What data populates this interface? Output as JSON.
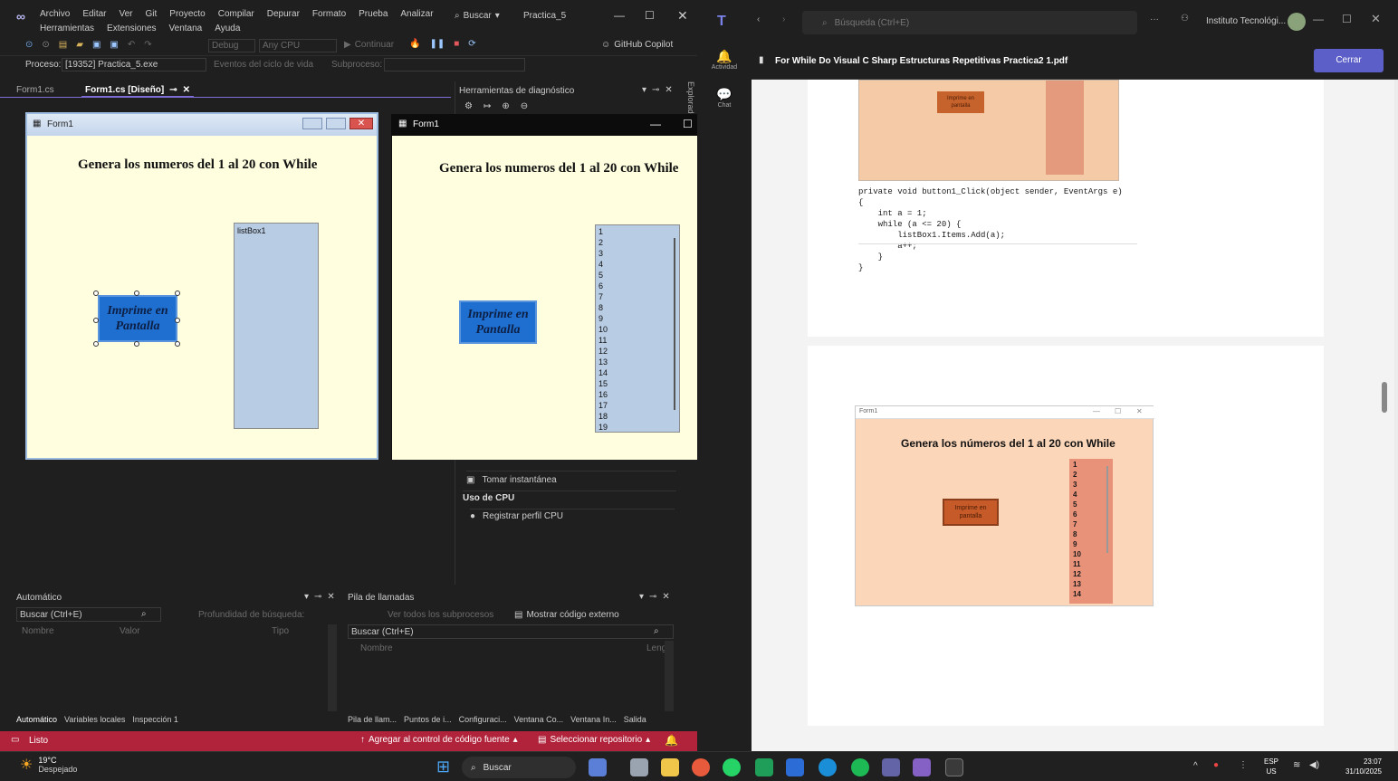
{
  "vs": {
    "menu": [
      "Archivo",
      "Editar",
      "Ver",
      "Git",
      "Proyecto",
      "Compilar",
      "Depurar",
      "Formato",
      "Prueba",
      "Analizar"
    ],
    "menu2": [
      "Herramientas",
      "Extensiones",
      "Ventana",
      "Ayuda"
    ],
    "search_label": "Buscar",
    "project_title": "Practica_5",
    "toolbar": {
      "config": "Debug",
      "platform": "Any CPU",
      "continue": "Continuar",
      "copilot": "GitHub Copilot"
    },
    "process_label": "Proceso:",
    "process_value": "[19352] Practica_5.exe",
    "lifecycle": "Eventos del ciclo de vida",
    "thread": "Subproceso:",
    "tabs": [
      "Form1.cs",
      "Form1.cs [Diseño]"
    ],
    "diag_title": "Herramientas de diagnóstico",
    "snapshot": "Tomar instantánea",
    "cpu_section": "Uso de CPU",
    "cpu_record": "Registrar perfil CPU",
    "auto_panel": {
      "title": "Automático",
      "search": "Buscar (Ctrl+E)",
      "depth": "Profundidad de búsqueda:",
      "cols": [
        "Nombre",
        "Valor",
        "Tipo"
      ],
      "tabs": [
        "Automático",
        "Variables locales",
        "Inspección 1"
      ]
    },
    "call_panel": {
      "title": "Pila de llamadas",
      "view_all": "Ver todos los subprocesos",
      "show_ext": "Mostrar código externo",
      "search": "Buscar (Ctrl+E)",
      "cols": [
        "Nombre",
        "Leng"
      ],
      "tabs": [
        "Pila de llam...",
        "Puntos de i...",
        "Configuraci...",
        "Ventana Co...",
        "Ventana In...",
        "Salida"
      ]
    },
    "status": {
      "ready": "Listo",
      "add_source": "Agregar al control de código fuente",
      "select_repo": "Seleccionar repositorio"
    },
    "side_tab": "Explorador"
  },
  "design_form": {
    "title": "Form1",
    "heading": "Genera los numeros del 1 al 20 con While",
    "button": "Imprime en Pantalla",
    "listbox_label": "listBox1"
  },
  "run_form": {
    "title": "Form1",
    "heading": "Genera los numeros del 1 al 20 con While",
    "button": "Imprime en Pantalla",
    "items": [
      "1",
      "2",
      "3",
      "4",
      "5",
      "6",
      "7",
      "8",
      "9",
      "10",
      "11",
      "12",
      "13",
      "14",
      "15",
      "16",
      "17",
      "18",
      "19"
    ]
  },
  "teams": {
    "search": "Búsqueda (Ctrl+E)",
    "org": "Instituto Tecnológi...",
    "side": [
      "Actividad",
      "Chat"
    ],
    "pdf_title": "For While Do Visual C Sharp Estructuras Repetitivas Practica2 1.pdf",
    "close": "Cerrar",
    "page1_button": "Imprime en pantalla",
    "code_lines": [
      "private void button1_Click(object sender, EventArgs e)",
      "{",
      "    int a = 1;",
      "    while (a <= 20) {",
      "        listBox1.Items.Add(a);",
      "        a++;",
      "    }",
      "}"
    ],
    "page2": {
      "form_title": "Form1",
      "heading": "Genera los números del 1 al 20 con While",
      "button": "Imprime en pantalla",
      "items": [
        "1",
        "2",
        "3",
        "4",
        "5",
        "6",
        "7",
        "8",
        "9",
        "10",
        "11",
        "12",
        "13",
        "14"
      ]
    }
  },
  "taskbar": {
    "temp": "19°C",
    "weather": "Despejado",
    "search": "Buscar",
    "lang": "ESP",
    "region": "US",
    "time": "23:07",
    "date": "31/10/2025"
  }
}
